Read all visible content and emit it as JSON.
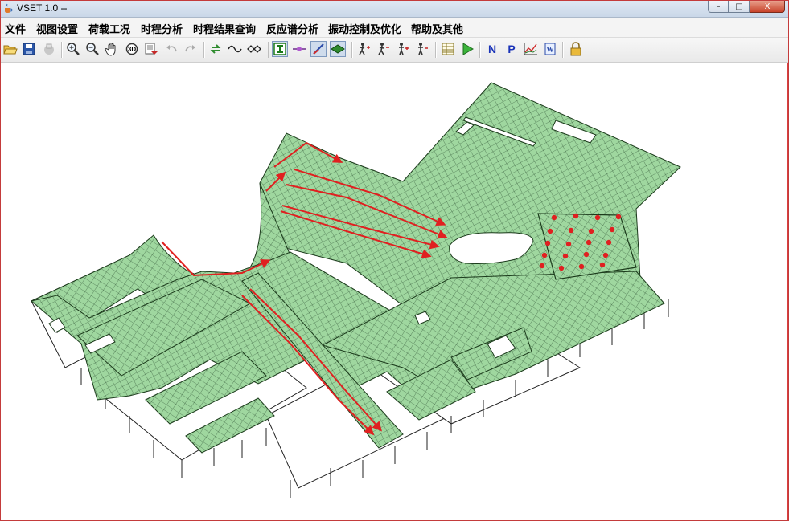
{
  "window": {
    "title": "VSET 1.0 --",
    "buttons": {
      "min": "–",
      "max": "□",
      "close": "X"
    }
  },
  "menu": {
    "items": [
      "文件",
      "视图设置",
      "荷载工况",
      "时程分析",
      "时程结果查询",
      "反应谱分析",
      "振动控制及优化",
      "帮助及其他"
    ]
  },
  "toolbar": {
    "buttons": [
      {
        "name": "open-icon"
      },
      {
        "name": "save-icon"
      },
      {
        "name": "print-icon"
      },
      {
        "name": "zoom-in-icon"
      },
      {
        "name": "zoom-out-icon"
      },
      {
        "name": "pan-hand-icon"
      },
      {
        "name": "rotate-3d-icon"
      },
      {
        "name": "export-image-icon"
      },
      {
        "name": "undo-icon"
      },
      {
        "name": "redo-icon"
      },
      {
        "name": "refresh-icon"
      },
      {
        "name": "wave-icon"
      },
      {
        "name": "link-icon"
      },
      {
        "name": "beam-icon",
        "pressed": true
      },
      {
        "name": "node-icon"
      },
      {
        "name": "line-element-icon",
        "pressed": true
      },
      {
        "name": "shell-element-icon",
        "pressed": true
      },
      {
        "name": "walker-add-icon"
      },
      {
        "name": "walker-remove-icon"
      },
      {
        "name": "person-add-icon"
      },
      {
        "name": "person-remove-icon"
      },
      {
        "name": "table-icon"
      },
      {
        "name": "run-icon"
      },
      {
        "name": "n-button",
        "text": "N"
      },
      {
        "name": "p-button",
        "text": "P"
      },
      {
        "name": "chart-icon"
      },
      {
        "name": "word-icon"
      },
      {
        "name": "lock-icon"
      }
    ]
  },
  "model": {
    "mesh_color": "#9fd79f",
    "grid_color": "#1f3f1f",
    "load_color": "#e02020"
  }
}
